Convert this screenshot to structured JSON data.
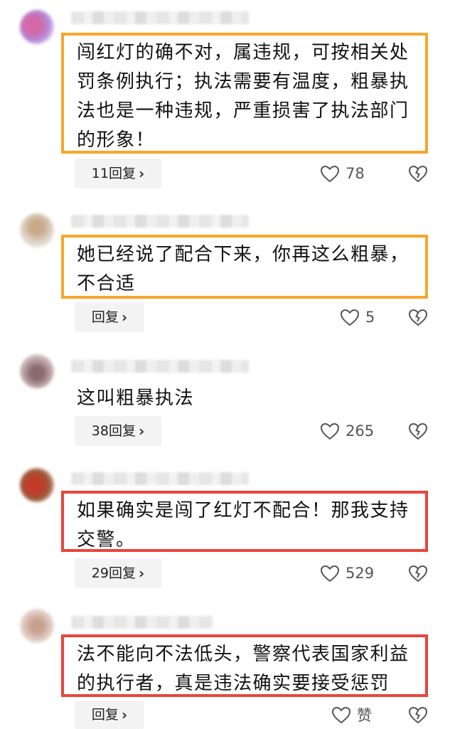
{
  "comments": [
    {
      "text": "闯红灯的确不对，属违规，可按相关处罚条例执行；执法需要有温度，粗暴执法也是一种违规，严重损害了执法部门的形象！",
      "reply_label": "11回复",
      "likes": "78",
      "highlight": "orange"
    },
    {
      "text": "她已经说了配合下来，你再这么粗暴，不合适",
      "reply_label": "回复",
      "likes": "5",
      "highlight": "orange"
    },
    {
      "text": "这叫粗暴执法",
      "reply_label": "38回复",
      "likes": "265",
      "highlight": "none"
    },
    {
      "text": "如果确实是闯了红灯不配合！那我支持交警。",
      "reply_label": "29回复",
      "likes": "529",
      "highlight": "red"
    },
    {
      "text": "法不能向不法低头，警察代表国家利益的执行者，真是违法确实要接受惩罚",
      "reply_label": "回复",
      "likes": "赞",
      "highlight": "red"
    }
  ],
  "colors": {
    "highlight_orange": "#f7a62b",
    "highlight_red": "#e8453c",
    "reply_button_bg": "#f3f3f3"
  },
  "icons": {
    "reply_chevron": "chevron-right-icon",
    "like": "heart-outline-icon",
    "dislike": "broken-heart-icon"
  }
}
